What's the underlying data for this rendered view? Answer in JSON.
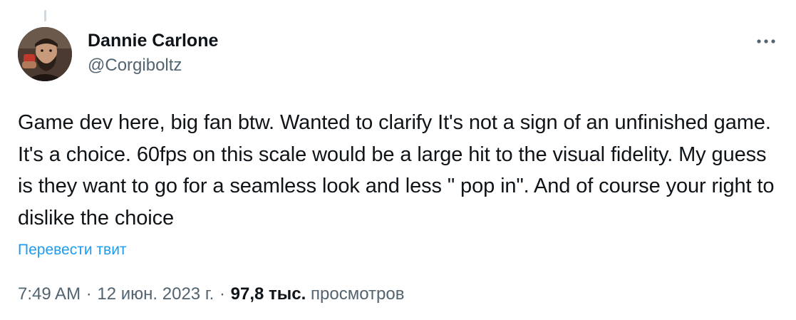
{
  "author": {
    "display_name": "Dannie Carlone",
    "handle": "@Corgiboltz"
  },
  "tweet": {
    "text": "Game dev here, big fan btw. Wanted to clarify It's not a sign of an unfinished game. It's a choice. 60fps on this scale would be a large hit to the visual fidelity. My guess is they want to go for a seamless look and less \" pop in\". And of course your right to dislike the choice",
    "translate_label": "Перевести твит",
    "time": "7:49 AM",
    "separator": "·",
    "date": "12 июн. 2023 г.",
    "views_count": "97,8 тыс.",
    "views_label": "просмотров"
  },
  "icons": {
    "more": "more-horizontal-icon",
    "avatar": "avatar-photo"
  },
  "colors": {
    "text": "#0f1419",
    "secondary": "#536471",
    "link": "#1d9bf0",
    "thread_line": "#cfd9de"
  }
}
